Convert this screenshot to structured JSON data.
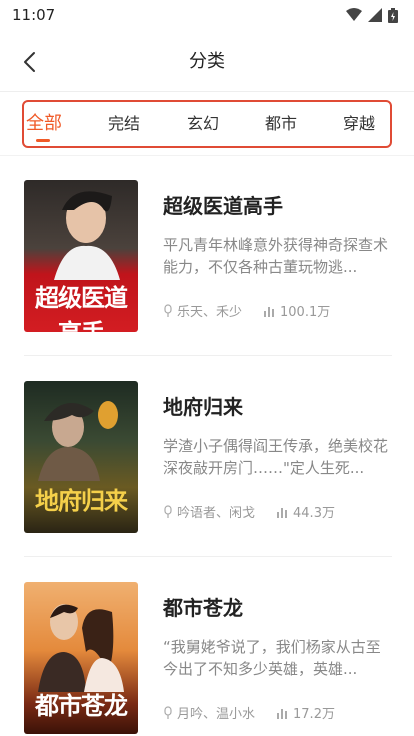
{
  "status": {
    "time": "11:07"
  },
  "header": {
    "title": "分类"
  },
  "tabs": [
    {
      "label": "全部",
      "active": true
    },
    {
      "label": "完结",
      "active": false
    },
    {
      "label": "玄幻",
      "active": false
    },
    {
      "label": "都市",
      "active": false
    },
    {
      "label": "穿越",
      "active": false
    }
  ],
  "colors": {
    "accent": "#f05a28",
    "highlight_border": "#e04b35"
  },
  "books": [
    {
      "title": "超级医道高手",
      "description": "平凡青年林峰意外获得神奇探查术能力，不仅各种古董玩物逃...",
      "authors": "乐天、禾少",
      "count": "100.1万",
      "cover_text": "超级医道高手"
    },
    {
      "title": "地府归来",
      "description": "学渣小子偶得阎王传承，绝美校花深夜敲开房门……\"定人生死...",
      "authors": "吟语者、闲戈",
      "count": "44.3万",
      "cover_text": "地府归来"
    },
    {
      "title": "都市苍龙",
      "description": "“我舅姥爷说了，我们杨家从古至今出了不知多少英雄，英雄...",
      "authors": "月吟、温小水",
      "count": "17.2万",
      "cover_text": "都市苍龙"
    }
  ]
}
